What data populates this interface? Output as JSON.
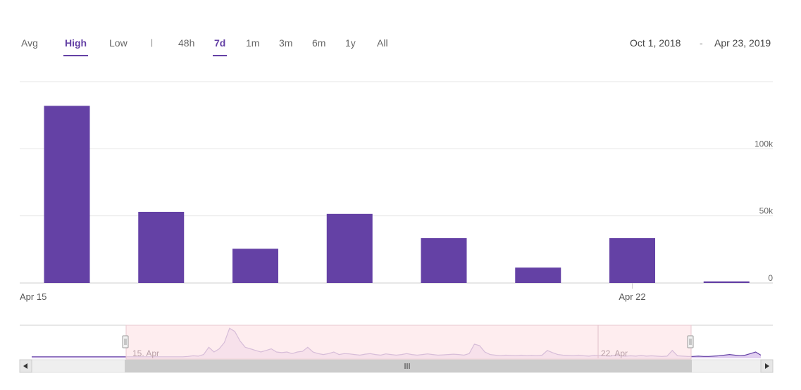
{
  "toolbar": {
    "metrics": [
      "Avg",
      "High",
      "Low"
    ],
    "active_metric": "High",
    "separator": "|",
    "ranges": [
      "48h",
      "7d",
      "1m",
      "3m",
      "6m",
      "1y",
      "All"
    ],
    "active_range": "7d",
    "date_from": "Oct 1, 2018",
    "date_dash": "-",
    "date_to": "Apr 23, 2019"
  },
  "colors": {
    "accent": "#6441a5",
    "bar": "#6441a5",
    "grid": "#e6e6e6",
    "navigator_mask": "#fde7ea",
    "navigator_series": "#e1cff0"
  },
  "chart_data": {
    "type": "bar",
    "x": [
      "2019-04-15",
      "2019-04-16",
      "2019-04-17",
      "2019-04-18",
      "2019-04-19",
      "2019-04-20",
      "2019-04-21",
      "2019-04-22"
    ],
    "values": [
      132000,
      53000,
      25500,
      51500,
      33500,
      11500,
      33500,
      1200
    ],
    "x_tick_labels": [
      "Apr 15",
      "Apr 22"
    ],
    "y_tick_labels": [
      "0",
      "50k",
      "100k"
    ],
    "ylim": [
      0,
      150000
    ],
    "grid": true,
    "y_axis_side": "right",
    "title": "",
    "xlabel": "",
    "ylabel": ""
  },
  "navigator": {
    "labels": [
      "15. Apr",
      "22. Apr"
    ],
    "series": [
      0.05,
      0.05,
      0.05,
      0.05,
      0.05,
      0.05,
      0.05,
      0.05,
      0.05,
      0.05,
      0.05,
      0.05,
      0.05,
      0.05,
      0.05,
      0.05,
      0.05,
      0.05,
      0.05,
      0.05,
      0.05,
      0.05,
      0.05,
      0.05,
      0.05,
      0.05,
      0.05,
      0.05,
      0.05,
      0.05,
      0.06,
      0.08,
      0.07,
      0.12,
      0.35,
      0.2,
      0.3,
      0.5,
      0.95,
      0.85,
      0.55,
      0.35,
      0.3,
      0.25,
      0.2,
      0.25,
      0.3,
      0.2,
      0.18,
      0.2,
      0.15,
      0.2,
      0.22,
      0.35,
      0.2,
      0.15,
      0.12,
      0.15,
      0.2,
      0.12,
      0.15,
      0.14,
      0.12,
      0.1,
      0.13,
      0.15,
      0.12,
      0.1,
      0.14,
      0.12,
      0.1,
      0.12,
      0.15,
      0.12,
      0.1,
      0.12,
      0.14,
      0.12,
      0.1,
      0.11,
      0.12,
      0.13,
      0.12,
      0.1,
      0.15,
      0.45,
      0.4,
      0.2,
      0.12,
      0.1,
      0.08,
      0.1,
      0.09,
      0.08,
      0.1,
      0.08,
      0.09,
      0.08,
      0.1,
      0.25,
      0.18,
      0.12,
      0.1,
      0.09,
      0.08,
      0.1,
      0.08,
      0.07,
      0.09,
      0.08,
      0.08,
      0.07,
      0.09,
      0.08,
      0.07,
      0.08,
      0.07,
      0.09,
      0.07,
      0.08,
      0.07,
      0.06,
      0.07,
      0.25,
      0.08,
      0.07,
      0.06,
      0.06,
      0.07,
      0.06,
      0.06,
      0.07,
      0.08,
      0.1,
      0.12,
      0.1,
      0.08,
      0.1,
      0.15,
      0.2,
      0.1
    ]
  }
}
